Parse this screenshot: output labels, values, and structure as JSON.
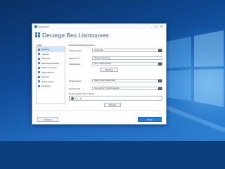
{
  "window": {
    "title": "Datenbank",
    "controls": {
      "minimize": "–",
      "maximize": "☐",
      "close": "✕"
    }
  },
  "header": {
    "title": "Decarge Bes Listmouves",
    "icon": "app-grid-icon"
  },
  "sidebar": {
    "label": "Lisats",
    "items": [
      {
        "label": "Einleses",
        "icon": "list-icon",
        "selected": true
      },
      {
        "label": "Inrenerri",
        "icon": "user-icon"
      },
      {
        "label": "Mecnorzy",
        "icon": "folder-icon"
      },
      {
        "label": "Sperchersachseha",
        "icon": "bookmark-icon"
      },
      {
        "label": "Sehen Listmous",
        "icon": "eye-icon"
      },
      {
        "label": "Vtaundefahss",
        "icon": "settings-icon"
      },
      {
        "label": "Sestode",
        "icon": "tag-icon"
      },
      {
        "label": "Srrferunsdes",
        "icon": "filter-icon"
      },
      {
        "label": "Fimfletem",
        "icon": "page-icon"
      }
    ]
  },
  "main": {
    "section_title": "Besetschandischtg pederne",
    "fields": [
      {
        "label": "Prefercament",
        "value": "Gesuctdes"
      },
      {
        "label": "Diateu2 eh",
        "value": "Sterlens kanecrtes"
      },
      {
        "label": "Lifelcaletasz",
        "value": "Aeurz letnunsenhes"
      }
    ],
    "middle_button": "Stutecry",
    "fields2": [
      {
        "label": "Dinkesrgeres",
        "value": "Fekstr frasyy fesenmede"
      },
      {
        "label": "Densnorrels",
        "value": "Izer Leatme 5 csshre laspaise"
      }
    ],
    "radio_section": "Nrgceny laben ExJerugauo",
    "radio_value": "1 0 · 9",
    "small_button": "Wenpar"
  },
  "footer": {
    "cancel": "Vrehsten",
    "save": "Sacde"
  },
  "colors": {
    "accent": "#2b7bd6",
    "title_text": "#2a5f9e",
    "selection": "#d4e4f7"
  }
}
